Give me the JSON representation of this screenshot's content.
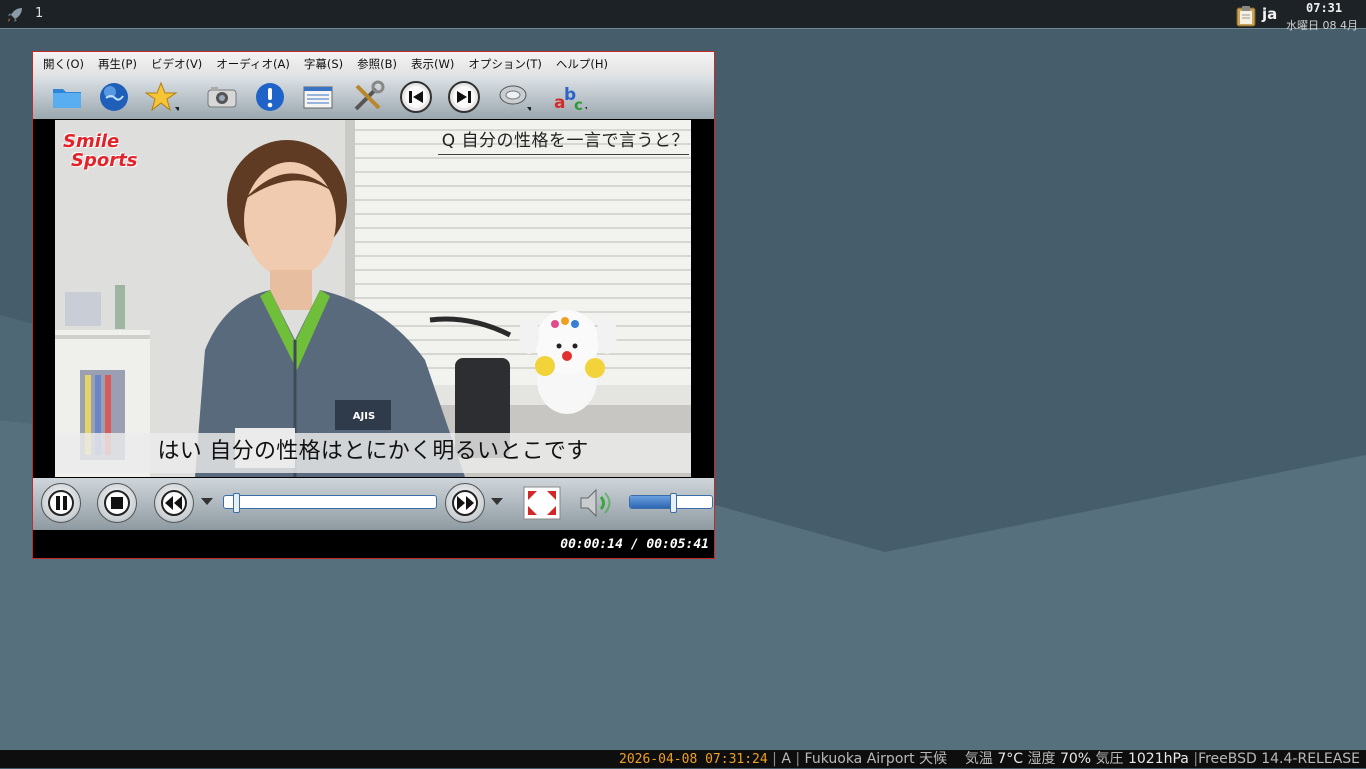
{
  "panel": {
    "workspace": "1",
    "language": "ja",
    "time": "07:31",
    "date": "水曜日 08 4月"
  },
  "player": {
    "menu": [
      {
        "label": "開く(O)"
      },
      {
        "label": "再生(P)"
      },
      {
        "label": "ビデオ(V)"
      },
      {
        "label": "オーディオ(A)"
      },
      {
        "label": "字幕(S)"
      },
      {
        "label": "参照(B)"
      },
      {
        "label": "表示(W)"
      },
      {
        "label": "オプション(T)"
      },
      {
        "label": "ヘルプ(H)"
      }
    ],
    "toolbar_icons": [
      "folder-icon",
      "globe-icon",
      "star-icon",
      "camera-icon",
      "info-icon",
      "playlist-icon",
      "tools-icon",
      "previous-icon",
      "next-icon",
      "speaker-icon",
      "abc-icon"
    ],
    "video": {
      "logo_line1": "Smile",
      "logo_line2": "Sports",
      "question": "Q 自分の性格を一言で言うと？",
      "subtitle": "はい 自分の性格はとにかく明るいとこです"
    },
    "controls": {
      "seek_progress": 0.041,
      "volume_level": 0.52
    },
    "timecode": "00:00:14 / 00:05:41"
  },
  "statusbar": {
    "datetime": "2026-04-08 07:31:24",
    "mode": "A",
    "location": "Fukuoka Airport 天候",
    "temp_label": "気温",
    "temp_value": "7°C",
    "humidity_label": "湿度",
    "humidity_value": "70%",
    "pressure_label": "気圧",
    "pressure_value": "1021hPa",
    "os": "FreeBSD 14.4-RELEASE"
  },
  "colors": {
    "window_border": "#c42a2a",
    "clock_accent": "#f0a020",
    "desktop": "#455c6a"
  }
}
